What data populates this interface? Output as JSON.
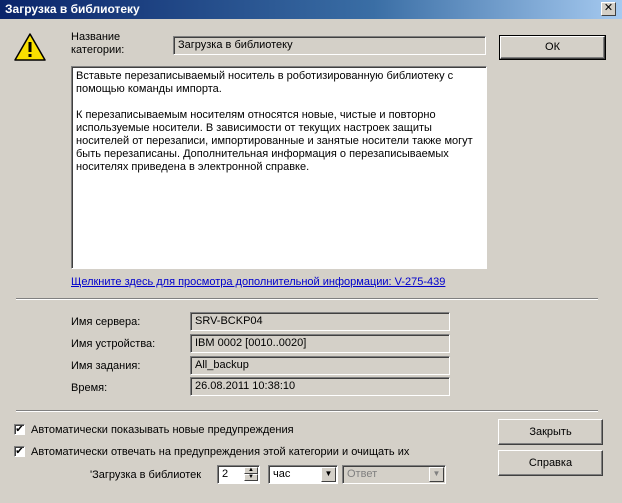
{
  "window": {
    "title": "Загрузка в библиотеку",
    "close_glyph": "✕"
  },
  "category": {
    "label_line1": "Название",
    "label_line2": "категории:",
    "value": "Загрузка в библиотеку"
  },
  "message": {
    "paragraph1": "Вставьте перезаписываемый носитель в роботизированную библиотеку с помощью команды импорта.",
    "paragraph2": "К перезаписываемым носителям относятся новые, чистые и повторно используемые носители. В зависимости от текущих настроек защиты носителей от перезаписи, импортированные и занятые носители также могут быть перезаписаны. Дополнительная информация о перезаписываемых носителях приведена в электронной справке."
  },
  "more_info_link": "Щелкните здесь для просмотра дополнительной информации: V-275-439",
  "details": {
    "server_label": "Имя сервера:",
    "server_value": "SRV-BCKP04",
    "device_label": "Имя устройства:",
    "device_value": "IBM 0002 [0010..0020]",
    "job_label": "Имя задания:",
    "job_value": "All_backup",
    "time_label": "Время:",
    "time_value": "26.08.2011 10:38:10"
  },
  "buttons": {
    "ok": "ОК",
    "close": "Закрыть",
    "help": "Справка"
  },
  "options": {
    "auto_show_label": "Автоматически показывать новые предупреждения",
    "auto_show_checked": true,
    "auto_reply_label": "Автоматически отвечать на предупреждения этой категории и очищать их",
    "auto_reply_checked": true,
    "check_glyph": "✔",
    "category_label": "'Загрузка в библиотек",
    "interval_value": "2",
    "unit_value": "час",
    "answer_value": "Ответ"
  },
  "colors": {
    "title_bar": "#0a246a",
    "dialog_bg": "#d4d0c8",
    "link": "#0000cc",
    "warning_yellow": "#f8e000"
  },
  "icons": {
    "warning": "warning-icon",
    "spin_up": "▲",
    "spin_down": "▼",
    "dropdown": "▼"
  }
}
